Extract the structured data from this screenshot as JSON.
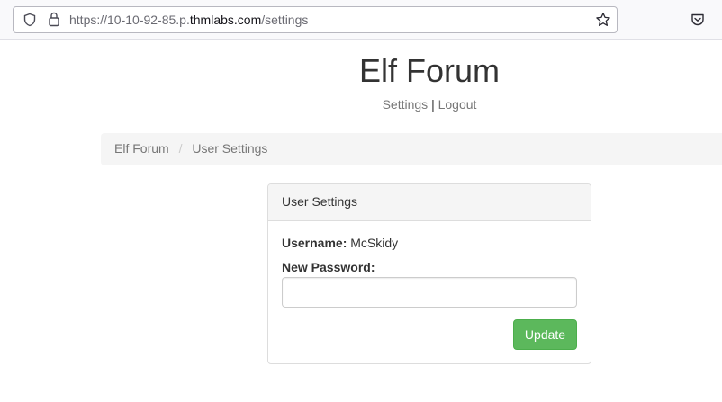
{
  "browser": {
    "url_prefix": "https://10-10-92-85.p.",
    "url_domain": "thmlabs.com",
    "url_path": "/settings",
    "icons": [
      "shield-icon",
      "lock-icon",
      "star-icon",
      "pocket-icon"
    ]
  },
  "site": {
    "title": "Elf Forum",
    "nav": {
      "settings_label": "Settings",
      "separator": "|",
      "logout_label": "Logout"
    }
  },
  "breadcrumb": {
    "items": [
      "Elf Forum",
      "User Settings"
    ],
    "separator": "/"
  },
  "panel": {
    "heading": "User Settings",
    "username_label": "Username:",
    "username_value": "McSkidy",
    "password_label": "New Password:",
    "password_value": "",
    "update_label": "Update"
  },
  "colors": {
    "update_button": "#5cb85c",
    "breadcrumb_bg": "#f5f5f5",
    "panel_heading_bg": "#f5f5f5"
  }
}
